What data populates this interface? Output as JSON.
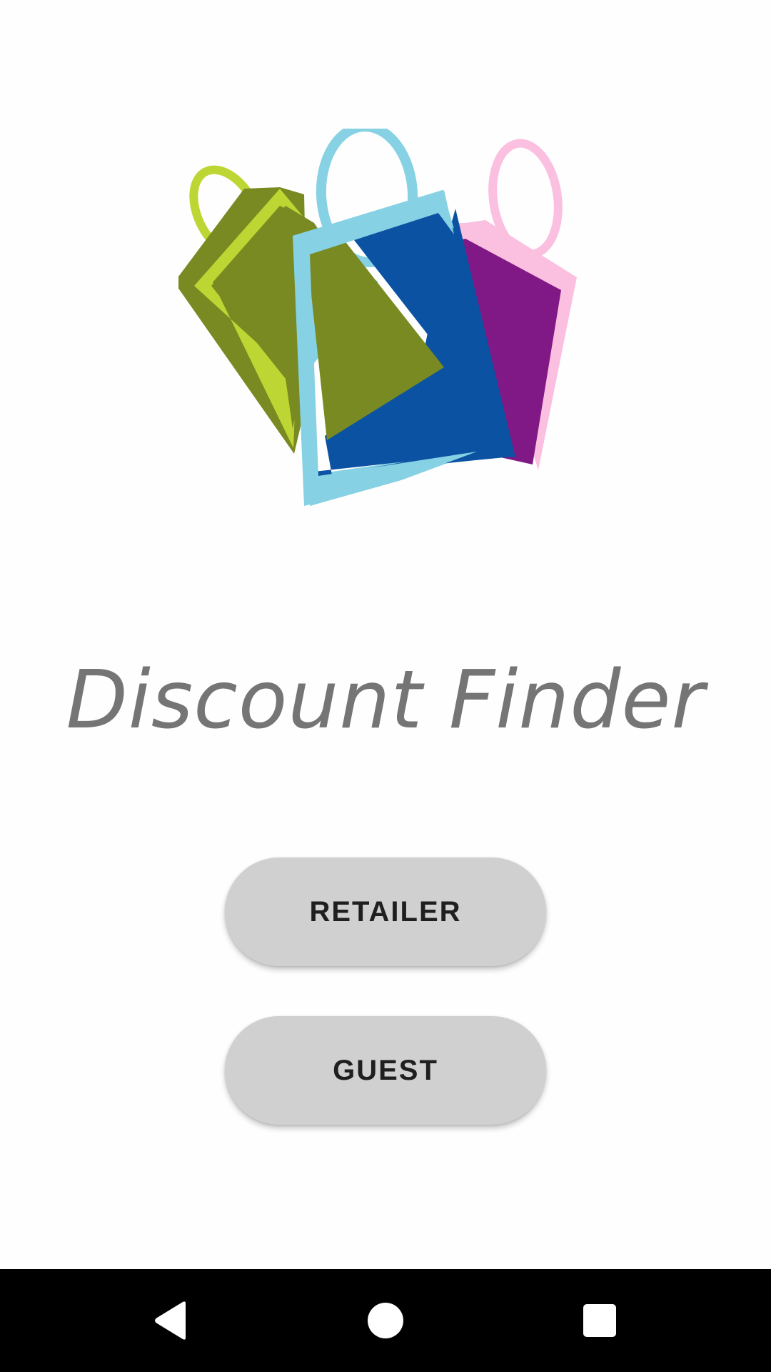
{
  "app": {
    "title": "Discount Finder",
    "logo_icon": "shopping-bags-logo"
  },
  "buttons": {
    "retailer_label": "RETAILER",
    "guest_label": "GUEST"
  },
  "navigation_bar": {
    "back_icon": "back-triangle-icon",
    "home_icon": "home-circle-icon",
    "recents_icon": "recents-square-icon"
  },
  "colors": {
    "title_text": "#757575",
    "button_background": "#d0d0d0",
    "button_text": "#1f1f1f",
    "nav_bar": "#000000",
    "bag_lime": "#bdd633",
    "bag_olive": "#788a21",
    "bag_light_blue": "#86d1e3",
    "bag_blue": "#0b52a3",
    "bag_pink": "#fbbfe0",
    "bag_purple": "#801886"
  }
}
